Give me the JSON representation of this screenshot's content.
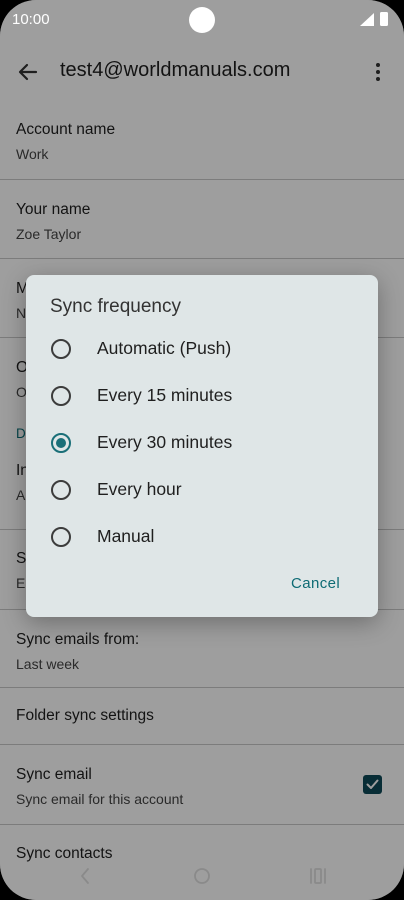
{
  "status_bar": {
    "time": "10:00"
  },
  "app_bar": {
    "title": "test4@worldmanuals.com"
  },
  "settings": [
    {
      "title": "Account name",
      "subtitle": "Work"
    },
    {
      "title": "Your name",
      "subtitle": "Zoe Taylor"
    },
    {
      "title": "M",
      "subtitle": "N"
    },
    {
      "title": "O",
      "subtitle": "O"
    }
  ],
  "section_header": "D",
  "settings2": [
    {
      "title": "In",
      "subtitle": "A"
    },
    {
      "title": "S",
      "subtitle": "E"
    },
    {
      "title": "Sync emails from:",
      "subtitle": "Last week"
    },
    {
      "title": "Folder sync settings"
    },
    {
      "title": "Sync email",
      "subtitle": "Sync email for this account",
      "checked": true
    },
    {
      "title": "Sync contacts"
    }
  ],
  "dialog": {
    "title": "Sync frequency",
    "options": [
      {
        "label": "Automatic (Push)",
        "selected": false
      },
      {
        "label": "Every 15 minutes",
        "selected": false
      },
      {
        "label": "Every 30 minutes",
        "selected": true
      },
      {
        "label": "Every hour",
        "selected": false
      },
      {
        "label": "Manual",
        "selected": false
      }
    ],
    "cancel_label": "Cancel"
  },
  "colors": {
    "accent": "#1a6f78",
    "checkbox": "#0d4a57",
    "dialog_bg": "#dfe6e7"
  },
  "icons": {
    "back": "arrow-back-icon",
    "menu": "more-vert-icon",
    "nav_back": "chevron-left-icon",
    "nav_home": "circle-home-icon",
    "nav_recents": "recents-bars-icon"
  }
}
